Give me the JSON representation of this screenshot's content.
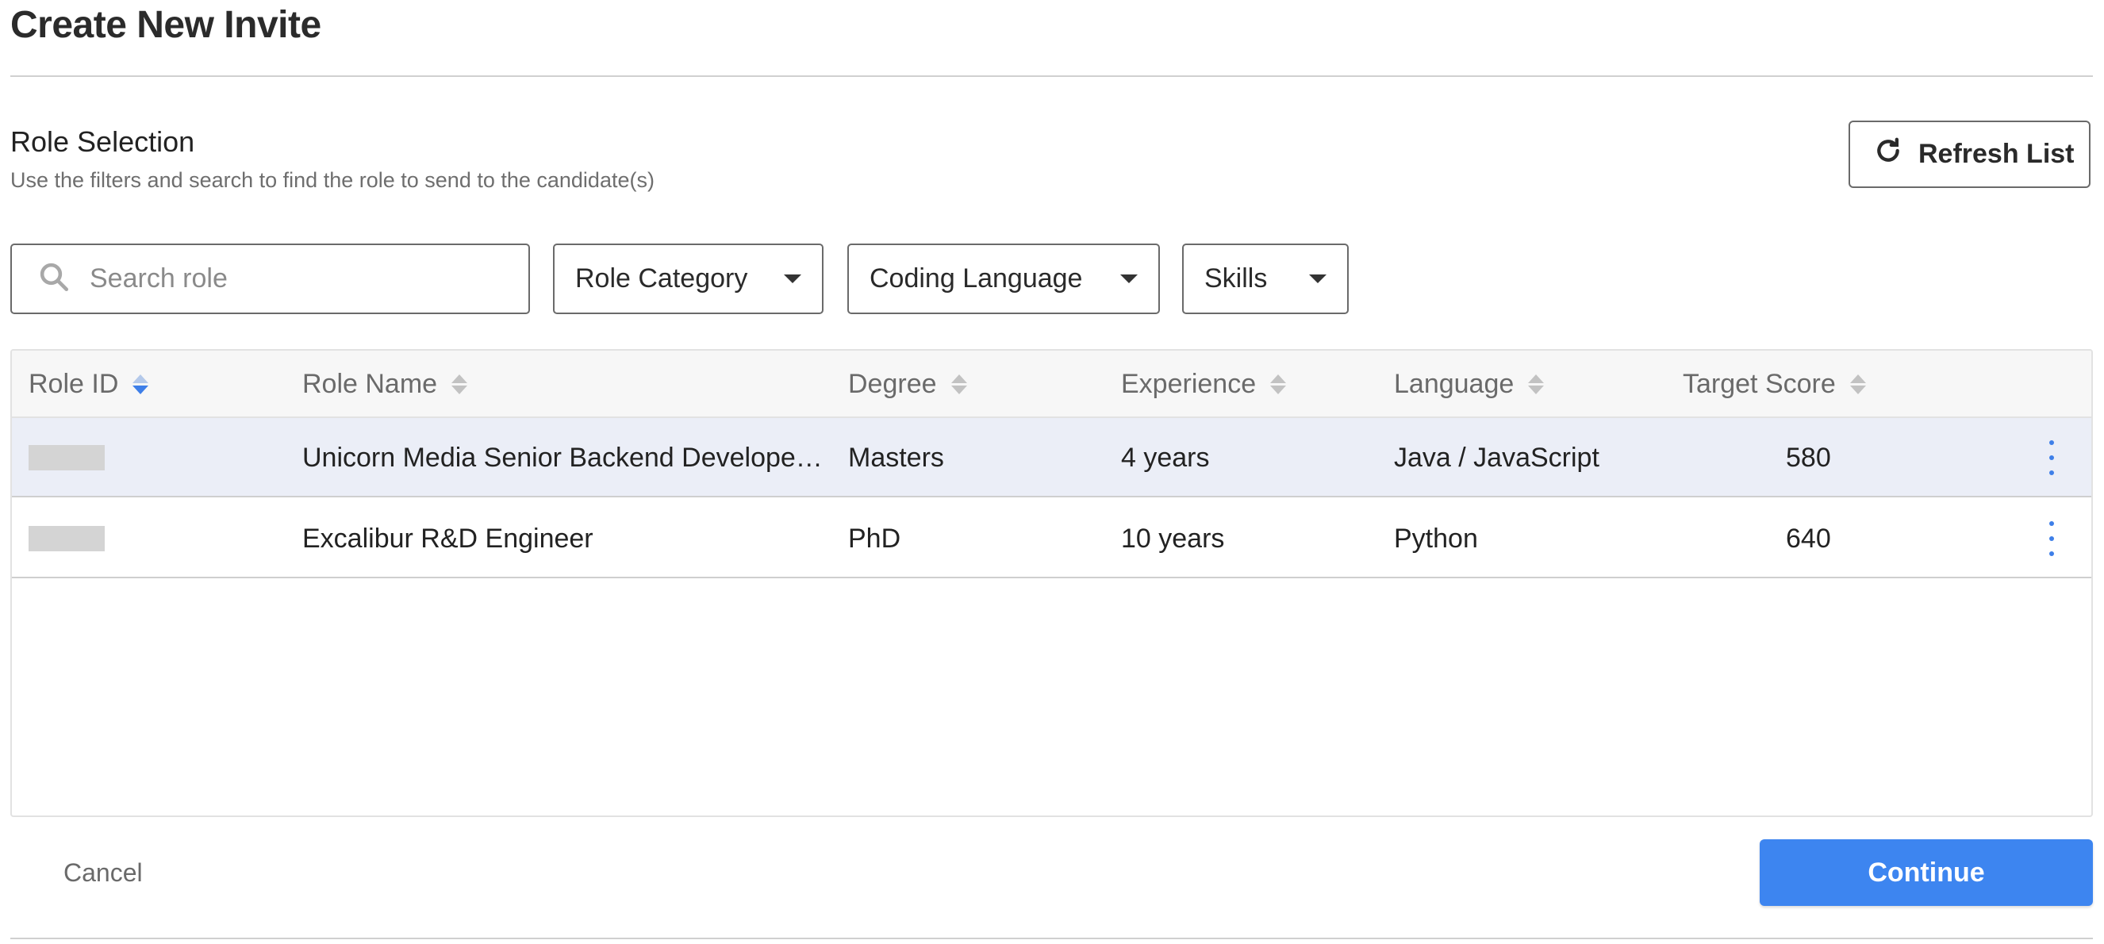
{
  "page": {
    "title": "Create New Invite"
  },
  "section": {
    "title": "Role Selection",
    "subtitle": "Use the filters and search to find the role to send to the candidate(s)"
  },
  "toolbar": {
    "refresh_label": "Refresh List",
    "refresh_icon": "refresh-icon"
  },
  "search": {
    "placeholder": "Search role",
    "value": "",
    "icon": "search-icon"
  },
  "filters": {
    "role_category": "Role Category",
    "coding_language": "Coding Language",
    "skills": "Skills"
  },
  "table": {
    "columns": {
      "role_id": "Role ID",
      "role_name": "Role Name",
      "degree": "Degree",
      "experience": "Experience",
      "language": "Language",
      "target_score": "Target Score"
    },
    "sorted_by": "role_id",
    "rows": [
      {
        "role_name": "Unicorn Media Senior Backend Develope…",
        "degree": "Masters",
        "experience": "4 years",
        "language": "Java / JavaScript",
        "target_score": "580",
        "selected": true
      },
      {
        "role_name": "Excalibur R&D Engineer",
        "degree": "PhD",
        "experience": "10 years",
        "language": "Python",
        "target_score": "640",
        "selected": false
      }
    ]
  },
  "footer": {
    "cancel_label": "Cancel",
    "continue_label": "Continue"
  },
  "colors": {
    "accent": "#3d85f0",
    "selected_row": "#ebeef7"
  }
}
